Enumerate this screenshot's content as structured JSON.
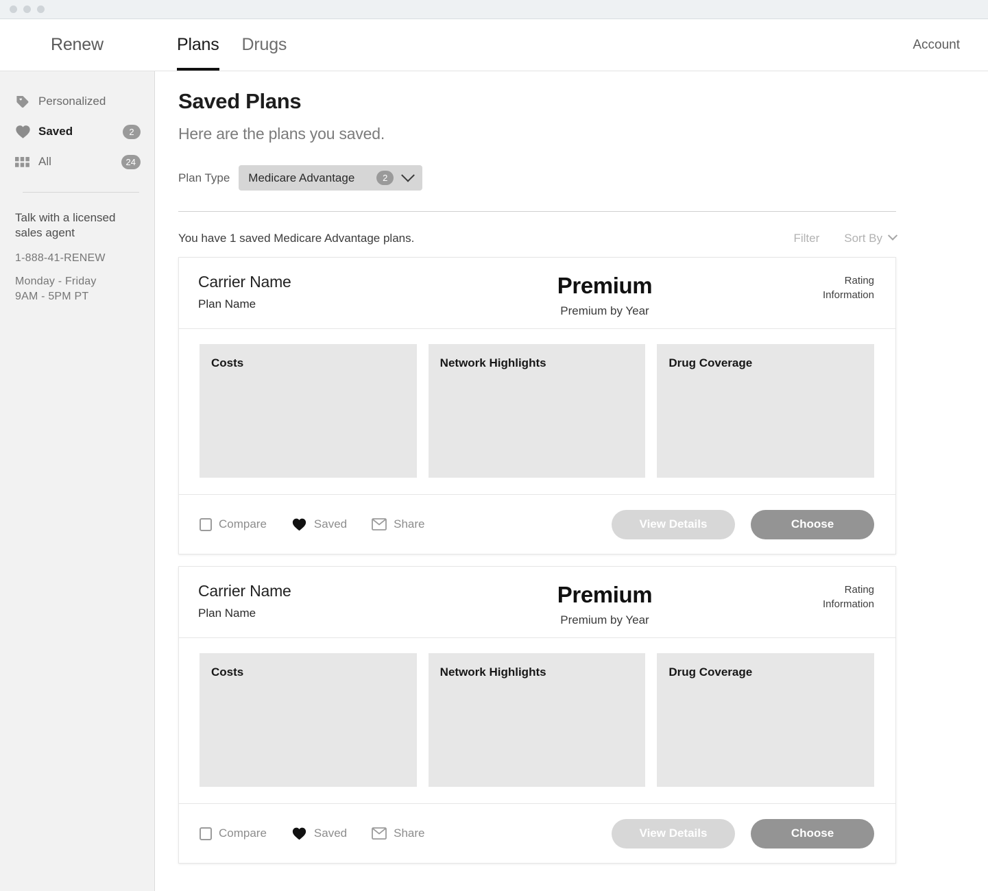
{
  "window": {
    "dots": [
      "close-dot",
      "minimize-dot",
      "zoom-dot"
    ]
  },
  "topnav": {
    "brand": "Renew",
    "tabs": [
      {
        "label": "Plans",
        "active": true
      },
      {
        "label": "Drugs",
        "active": false
      }
    ],
    "account_label": "Account"
  },
  "sidebar": {
    "items": [
      {
        "label": "Personalized",
        "icon": "tag-icon",
        "badge": null,
        "active": false
      },
      {
        "label": "Saved",
        "icon": "heart-icon",
        "badge": "2",
        "active": true
      },
      {
        "label": "All",
        "icon": "grid-icon",
        "badge": "24",
        "active": false
      }
    ],
    "help": {
      "title": "Talk with a licensed sales agent",
      "phone": "1-888-41-RENEW",
      "days": "Monday - Friday",
      "hours": "9AM - 5PM PT"
    }
  },
  "main": {
    "title": "Saved Plans",
    "subtitle": "Here are the plans you saved.",
    "plan_type": {
      "label": "Plan Type",
      "value": "Medicare Advantage",
      "badge": "2"
    },
    "result_count": "You have 1 saved Medicare Advantage plans.",
    "filter_label": "Filter",
    "sort_label": "Sort By"
  },
  "cards": [
    {
      "carrier": "Carrier Name",
      "plan_name": "Plan Name",
      "premium": "Premium",
      "premium_sub": "Premium by Year",
      "rating_line1": "Rating",
      "rating_line2": "Information",
      "panels": [
        {
          "title": "Costs"
        },
        {
          "title": "Network Highlights"
        },
        {
          "title": "Drug Coverage"
        }
      ],
      "actions": [
        {
          "label": "Compare",
          "icon": "checkbox-icon"
        },
        {
          "label": "Saved",
          "icon": "heart-icon"
        },
        {
          "label": "Share",
          "icon": "envelope-icon"
        }
      ],
      "view_details_label": "View Details",
      "choose_label": "Choose"
    },
    {
      "carrier": "Carrier Name",
      "plan_name": "Plan Name",
      "premium": "Premium",
      "premium_sub": "Premium by Year",
      "rating_line1": "Rating",
      "rating_line2": "Information",
      "panels": [
        {
          "title": "Costs"
        },
        {
          "title": "Network Highlights"
        },
        {
          "title": "Drug Coverage"
        }
      ],
      "actions": [
        {
          "label": "Compare",
          "icon": "checkbox-icon"
        },
        {
          "label": "Saved",
          "icon": "heart-icon"
        },
        {
          "label": "Share",
          "icon": "envelope-icon"
        }
      ],
      "view_details_label": "View Details",
      "choose_label": "Choose"
    }
  ],
  "colors": {
    "sidebar_bg": "#f2f2f2",
    "panel_bg": "#e7e7e7",
    "badge_bg": "#9a9a9a",
    "select_bg": "#d6d6d6",
    "btn_secondary": "#d7d7d7",
    "btn_primary": "#949494",
    "accent": "#111111"
  }
}
